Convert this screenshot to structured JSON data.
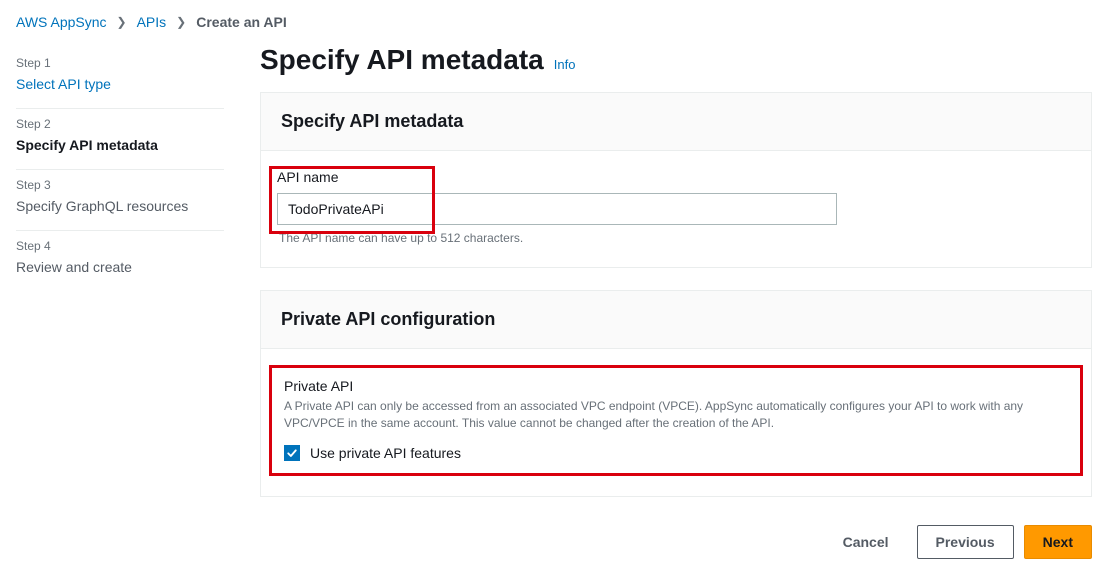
{
  "breadcrumb": {
    "root": "AWS AppSync",
    "mid": "APIs",
    "current": "Create an API"
  },
  "sidebar": {
    "steps": [
      {
        "label": "Step 1",
        "name": "Select API type",
        "state": "link"
      },
      {
        "label": "Step 2",
        "name": "Specify API metadata",
        "state": "active"
      },
      {
        "label": "Step 3",
        "name": "Specify GraphQL resources",
        "state": "normal"
      },
      {
        "label": "Step 4",
        "name": "Review and create",
        "state": "normal"
      }
    ]
  },
  "page": {
    "title": "Specify API metadata",
    "info": "Info"
  },
  "panel1": {
    "header": "Specify API metadata",
    "field_label": "API name",
    "field_value": "TodoPrivateAPi",
    "helper": "The API name can have up to 512 characters."
  },
  "panel2": {
    "header": "Private API configuration",
    "sub_title": "Private API",
    "description": "A Private API can only be accessed from an associated VPC endpoint (VPCE). AppSync automatically configures your API to work with any VPC/VPCE in the same account. This value cannot be changed after the creation of the API.",
    "checkbox_label": "Use private API features",
    "checked": true
  },
  "footer": {
    "cancel": "Cancel",
    "previous": "Previous",
    "next": "Next"
  }
}
